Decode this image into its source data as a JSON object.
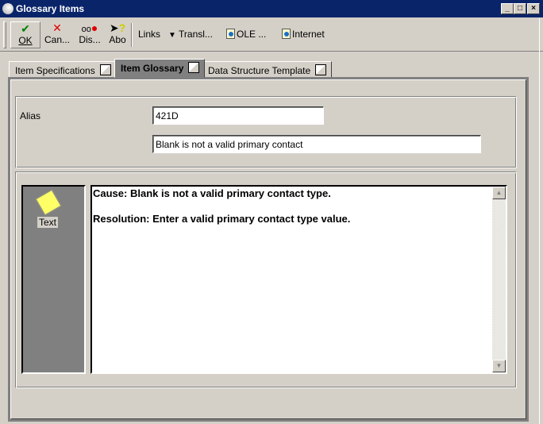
{
  "window": {
    "title": "Glossary Items"
  },
  "toolbar": {
    "buttons": [
      {
        "label": "OK",
        "icon": "checkmark-icon"
      },
      {
        "label": "Can...",
        "icon": "x-icon"
      },
      {
        "label": "Dis...",
        "icon": "display-glasses-icon"
      },
      {
        "label": "Abo",
        "icon": "pointer-help-icon"
      }
    ],
    "links_label": "Links",
    "links": [
      {
        "label": "Transl..."
      },
      {
        "label": "OLE ..."
      },
      {
        "label": "Internet"
      }
    ]
  },
  "tabs": [
    {
      "label": "Item Specifications",
      "active": false
    },
    {
      "label": "Item Glossary",
      "active": true
    },
    {
      "label": "Data Structure Template",
      "active": false
    }
  ],
  "form": {
    "alias_label": "Alias",
    "alias_value": "421D",
    "description_value": "Blank is not a valid primary contact"
  },
  "glossary": {
    "side_label": "Text",
    "cause": "Cause: Blank is not a valid primary contact type.",
    "resolution": "Resolution: Enter a valid primary contact type value."
  }
}
